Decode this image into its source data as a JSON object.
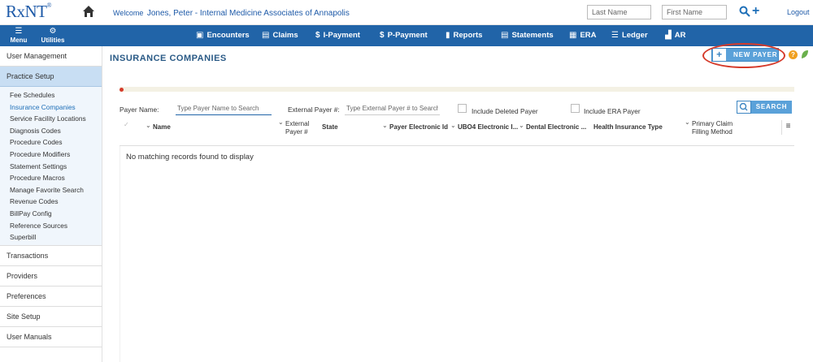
{
  "header": {
    "logo_text": "RxNT",
    "logo_mark": "®",
    "welcome_prefix": "Welcome",
    "welcome_user": "Jones, Peter - Internal Medicine Associates of Annapolis",
    "last_name_placeholder": "Last Name",
    "first_name_placeholder": "First Name",
    "logout_label": "Logout"
  },
  "nav": {
    "menu_label": "Menu",
    "utilities_label": "Utilities",
    "items": [
      {
        "label": "Encounters",
        "icon": "camera-icon"
      },
      {
        "label": "Claims",
        "icon": "list-icon"
      },
      {
        "label": "I-Payment",
        "icon": "dollar-icon"
      },
      {
        "label": "P-Payment",
        "icon": "dollar-icon"
      },
      {
        "label": "Reports",
        "icon": "document-icon"
      },
      {
        "label": "Statements",
        "icon": "statement-icon"
      },
      {
        "label": "ERA",
        "icon": "calendar-icon"
      },
      {
        "label": "Ledger",
        "icon": "ledger-icon"
      },
      {
        "label": "AR",
        "icon": "bar-chart-icon"
      }
    ]
  },
  "sidebar": {
    "sections": [
      {
        "label": "User Management"
      },
      {
        "label": "Practice Setup"
      },
      {
        "label": "Transactions"
      },
      {
        "label": "Providers"
      },
      {
        "label": "Preferences"
      },
      {
        "label": "Site Setup"
      },
      {
        "label": "User Manuals"
      }
    ],
    "practice_setup_items": [
      "Fee Schedules",
      "Insurance Companies",
      "Service Facility Locations",
      "Diagnosis Codes",
      "Procedure Codes",
      "Procedure Modifiers",
      "Statement Settings",
      "Procedure Macros",
      "Manage Favorite Search",
      "Revenue Codes",
      "BillPay Config",
      "Reference Sources",
      "Superbill"
    ]
  },
  "main": {
    "title": "INSURANCE COMPANIES",
    "new_payer_label": "NEW PAYER",
    "help_label": "?",
    "filters": {
      "payer_name_label": "Payer Name:",
      "payer_name_placeholder": "Type Payer Name to Search",
      "external_label": "External Payer #:",
      "external_placeholder": "Type External Payer # to Search",
      "include_deleted_label": "Include Deleted Payer",
      "include_era_label": "Include ERA Payer",
      "search_label": "SEARCH"
    },
    "columns": [
      "Name",
      "External Payer #",
      "State",
      "Payer Electronic Id",
      "UBO4 Electronic I...",
      "Dental Electronic ...",
      "Health Insurance Type",
      "Primary Claim Filling Method"
    ],
    "empty_message": "No matching records found to display"
  },
  "colors": {
    "nav_bg": "#2164a8",
    "accent": "#5aa1d9",
    "highlight_oval": "#d53a2a"
  }
}
